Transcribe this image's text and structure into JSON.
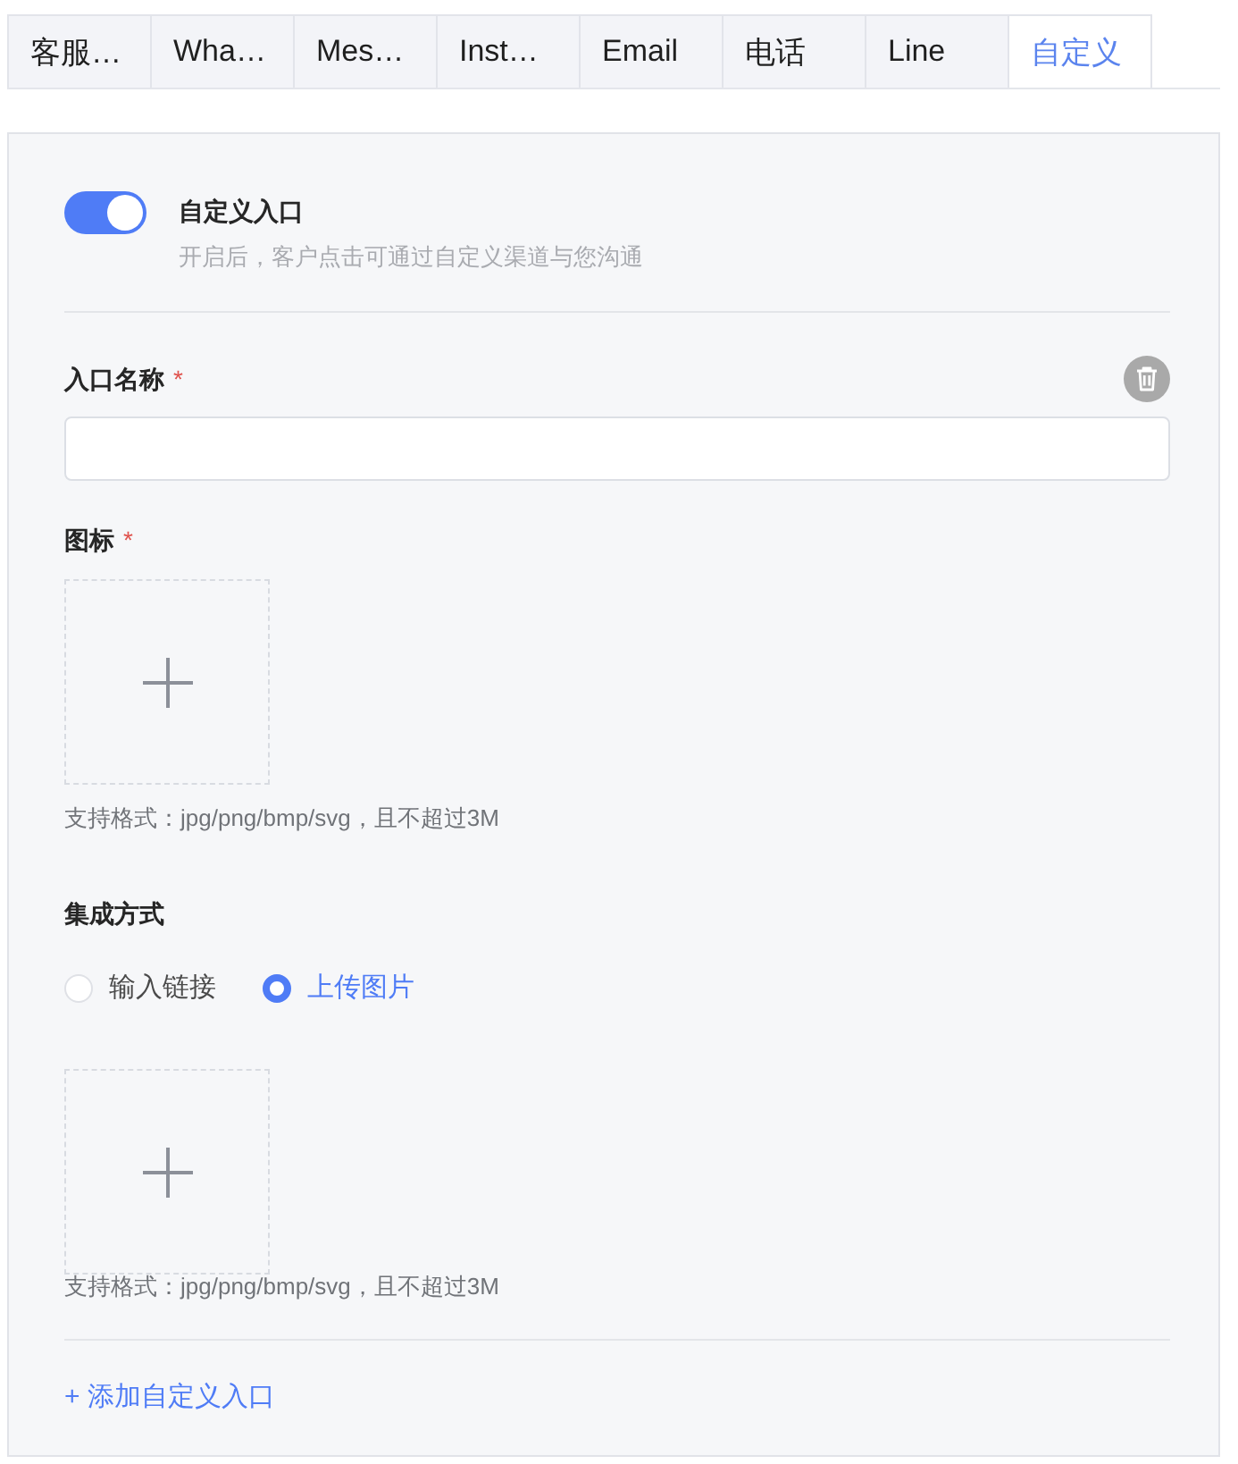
{
  "tabs": [
    {
      "label": "客服…",
      "selected": false
    },
    {
      "label": "Wha…",
      "selected": false
    },
    {
      "label": "Mes…",
      "selected": false
    },
    {
      "label": "Inst…",
      "selected": false
    },
    {
      "label": "Email",
      "selected": false
    },
    {
      "label": "电话",
      "selected": false
    },
    {
      "label": "Line",
      "selected": false
    },
    {
      "label": "自定义",
      "selected": true
    }
  ],
  "custom_entry": {
    "on": true,
    "title": "自定义入口",
    "description": "开启后，客户点击可通过自定义渠道与您沟通"
  },
  "name_field": {
    "label": "入口名称",
    "required_mark": "*"
  },
  "icon_field": {
    "label": "图标",
    "required_mark": "*",
    "hint": "支持格式：jpg/png/bmp/svg，且不超过3M"
  },
  "integration": {
    "label": "集成方式",
    "options": [
      {
        "label": "输入链接",
        "selected": false
      },
      {
        "label": "上传图片",
        "selected": true
      }
    ],
    "hint": "支持格式：jpg/png/bmp/svg，且不超过3M"
  },
  "add_link": "+ 添加自定义入口"
}
